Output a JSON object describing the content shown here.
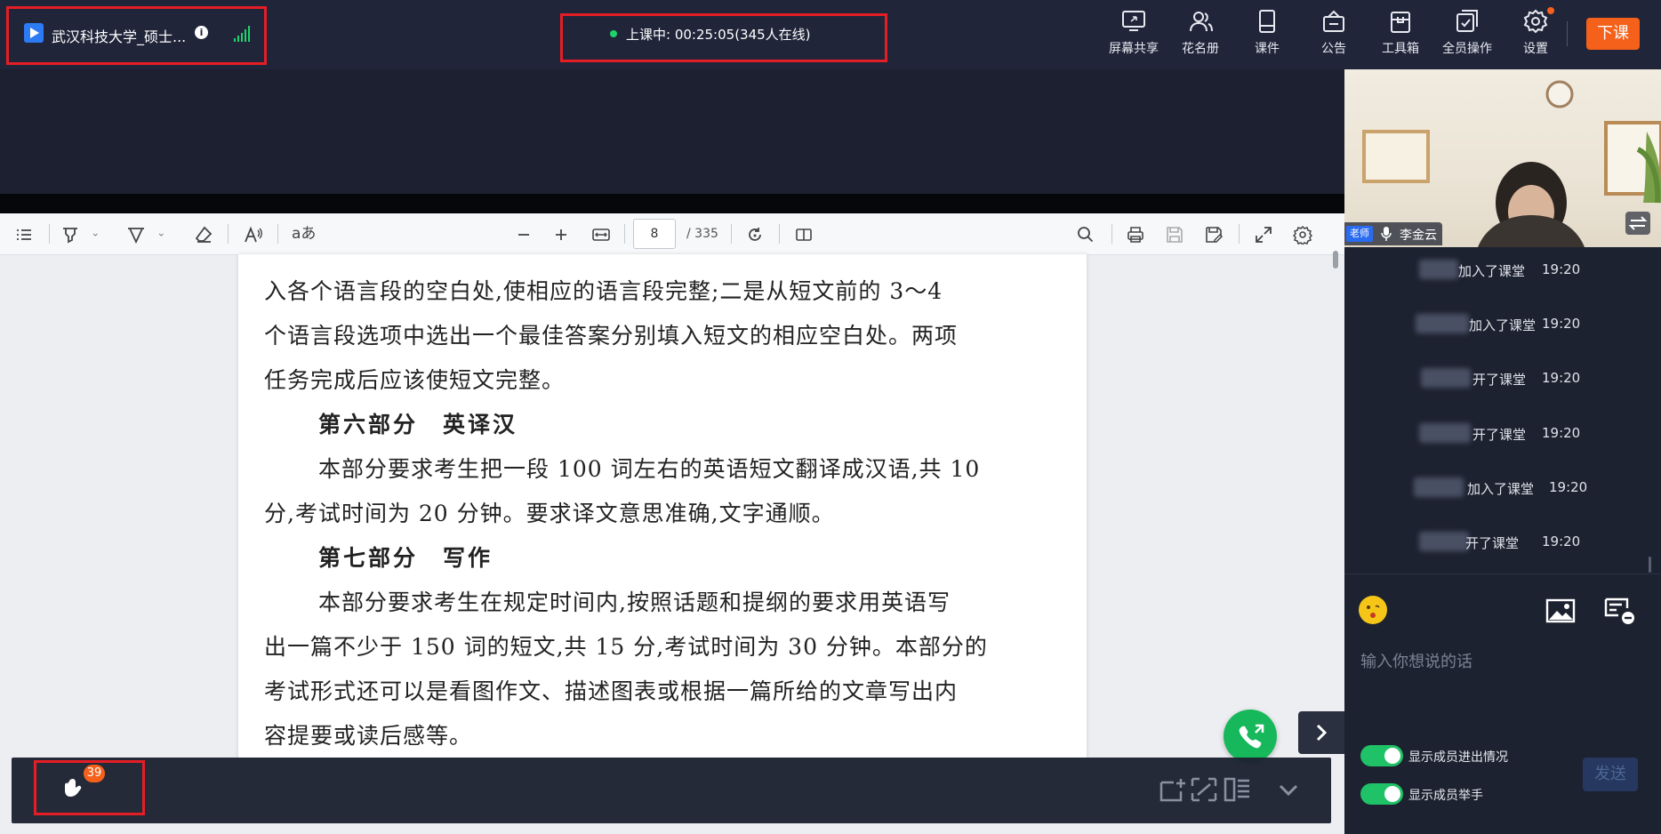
{
  "header": {
    "class_title": "武汉科技大学_硕士...",
    "info_icon": "info-icon",
    "status_text": "上课中: 00:25:05(345人在线)",
    "toolbar": [
      {
        "label": "屏幕共享",
        "icon": "screen-share-icon"
      },
      {
        "label": "花名册",
        "icon": "roster-icon"
      },
      {
        "label": "课件",
        "icon": "courseware-icon"
      },
      {
        "label": "公告",
        "icon": "announcement-icon"
      },
      {
        "label": "工具箱",
        "icon": "toolbox-icon"
      },
      {
        "label": "全员操作",
        "icon": "all-members-icon"
      },
      {
        "label": "设置",
        "icon": "settings-icon"
      }
    ],
    "end_class_label": "下课",
    "accent_color": "#f5601a",
    "highlight_color": "#e51e26"
  },
  "pdf": {
    "current_page": "8",
    "total_pages": "/ 335",
    "text_tool_label": "aあ",
    "lines": [
      "入各个语言段的空白处,使相应的语言段完整;二是从短文前的 3～4",
      "个语言段选项中选出一个最佳答案分别填入短文的相应空白处。两项",
      "任务完成后应该使短文完整。",
      "第六部分　英译汉",
      "本部分要求考生把一段 100 词左右的英语短文翻译成汉语,共 10",
      "分,考试时间为 20 分钟。要求译文意思准确,文字通顺。",
      "第七部分　写作",
      "本部分要求考生在规定时间内,按照话题和提纲的要求用英语写",
      "出一篇不少于 150 词的短文,共 15 分,考试时间为 30 分钟。本部分的",
      "考试形式还可以是看图作文、描述图表或根据一篇所给的文章写出内",
      "容提要或读后感等。"
    ]
  },
  "bottom_bar": {
    "hand_raise_count": "39"
  },
  "video": {
    "role_tag": "老师",
    "teacher_name": "李金云"
  },
  "chat": {
    "messages": [
      {
        "text": "加入了课堂",
        "time": "19:20"
      },
      {
        "text": "加入了课堂",
        "time": "19:20"
      },
      {
        "text": "开了课堂",
        "time": "19:20"
      },
      {
        "text": "开了课堂",
        "time": "19:20"
      },
      {
        "text": "加入了课堂",
        "time": "19:20"
      },
      {
        "text": "开了课堂",
        "time": "19:20"
      }
    ],
    "input_placeholder": "输入你想说的话",
    "toggle_show_join": "显示成员进出情况",
    "toggle_show_hands": "显示成员举手",
    "send_label": "发送"
  }
}
